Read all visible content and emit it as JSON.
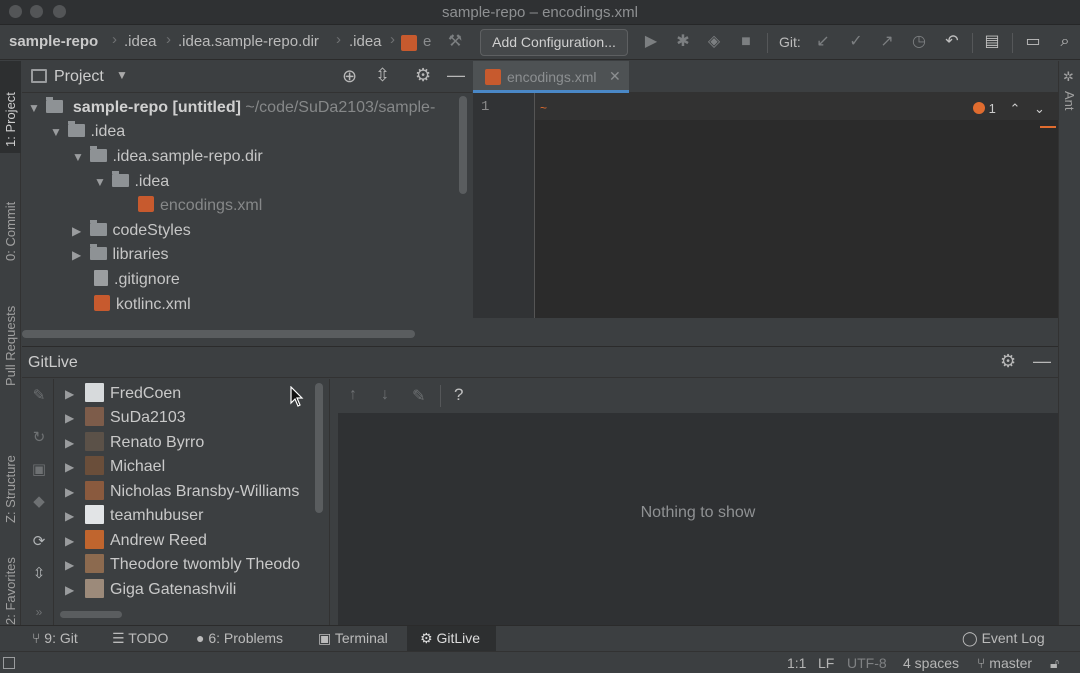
{
  "window": {
    "title": "sample-repo – encodings.xml"
  },
  "breadcrumbs": [
    "sample-repo",
    ".idea",
    ".idea.sample-repo.dir",
    ".idea",
    "e"
  ],
  "toolbar": {
    "add_configuration": "Add Configuration...",
    "git_label": "Git:"
  },
  "left_tabs": {
    "project": "1: Project",
    "commit": "0: Commit",
    "pull_requests": "Pull Requests",
    "structure": "Z: Structure",
    "favorites": "2: Favorites"
  },
  "right_tabs": {
    "ant": "Ant"
  },
  "project_panel": {
    "title": "Project",
    "tree": [
      {
        "label": "sample-repo",
        "suffix": "[untitled]",
        "path": "~/code/SuDa2103/sample-"
      },
      {
        "label": ".idea"
      },
      {
        "label": ".idea.sample-repo.dir"
      },
      {
        "label": ".idea"
      },
      {
        "label": "encodings.xml"
      },
      {
        "label": "codeStyles"
      },
      {
        "label": "libraries"
      },
      {
        "label": ".gitignore"
      },
      {
        "label": "kotlinc.xml"
      }
    ]
  },
  "editor": {
    "tab_label": "encodings.xml",
    "line_number": "1",
    "problem_count": "1"
  },
  "gitlive": {
    "title": "GitLive",
    "users": [
      "FredCoen",
      "SuDa2103",
      "Renato Byrro",
      "Michael",
      "Nicholas Bransby-Williams",
      "teamhubuser",
      "Andrew Reed",
      "Theodore twombly Theodo",
      "Giga Gatenashvili"
    ],
    "help_label": "?",
    "empty_text": "Nothing to show"
  },
  "bottom_tabs": {
    "git": "9: Git",
    "todo": "TODO",
    "problems": "6: Problems",
    "terminal": "Terminal",
    "gitlive": "GitLive",
    "event_log": "Event Log"
  },
  "status": {
    "position": "1:1",
    "line_sep": "LF",
    "encoding": "UTF-8",
    "indent": "4 spaces",
    "branch": "master"
  },
  "colors": {
    "accent": "#4a88c7",
    "xml_icon": "#c75a2e",
    "error": "#e06c2f"
  }
}
